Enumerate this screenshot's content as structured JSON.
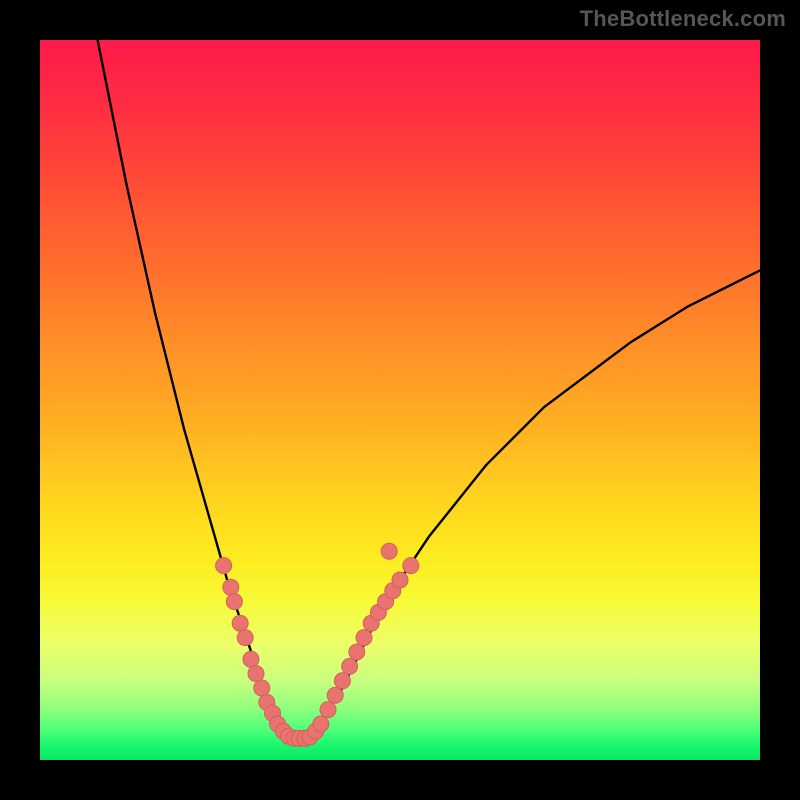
{
  "watermark": "TheBottleneck.com",
  "colors": {
    "background": "#000000",
    "curve": "#000000",
    "marker_fill": "#e9736f",
    "marker_stroke": "#d3605c",
    "gradient_stops": [
      {
        "pos": 0.0,
        "hex": "#ff1a4b"
      },
      {
        "pos": 0.3,
        "hex": "#ff6a2e"
      },
      {
        "pos": 0.64,
        "hex": "#ffd41e"
      },
      {
        "pos": 0.84,
        "hex": "#ecff6a"
      },
      {
        "pos": 1.0,
        "hex": "#0be765"
      }
    ]
  },
  "chart_data": {
    "type": "line",
    "title": "",
    "xlabel": "",
    "ylabel": "",
    "xlim": [
      0,
      100
    ],
    "ylim": [
      0,
      100
    ],
    "note": "y is plotted with 0 at bottom, 100 at top; values are estimated from pixel positions",
    "series": [
      {
        "name": "left-branch",
        "x": [
          8,
          10,
          12,
          14,
          16,
          18,
          20,
          22,
          24,
          26,
          27,
          28,
          29,
          30,
          31,
          32,
          33,
          34,
          35,
          36
        ],
        "y": [
          100,
          90,
          80,
          71,
          62,
          54,
          46,
          39,
          32,
          25,
          22,
          19,
          16,
          13,
          10,
          8,
          6,
          4,
          3,
          3
        ]
      },
      {
        "name": "right-branch",
        "x": [
          36,
          37,
          38,
          39,
          40,
          42,
          44,
          46,
          48,
          50,
          54,
          58,
          62,
          66,
          70,
          74,
          78,
          82,
          86,
          90,
          94,
          98,
          100
        ],
        "y": [
          3,
          3,
          4,
          5,
          7,
          10,
          14,
          18,
          21,
          25,
          31,
          36,
          41,
          45,
          49,
          52,
          55,
          58,
          60.5,
          63,
          65,
          67,
          68
        ]
      }
    ],
    "markers": [
      {
        "name": "left-cluster",
        "points": [
          {
            "x": 25.5,
            "y": 27
          },
          {
            "x": 26.5,
            "y": 24
          },
          {
            "x": 27.0,
            "y": 22
          },
          {
            "x": 27.8,
            "y": 19
          },
          {
            "x": 28.5,
            "y": 17
          },
          {
            "x": 29.3,
            "y": 14
          },
          {
            "x": 30.0,
            "y": 12
          },
          {
            "x": 30.8,
            "y": 10
          },
          {
            "x": 31.5,
            "y": 8
          },
          {
            "x": 32.3,
            "y": 6.5
          },
          {
            "x": 33.0,
            "y": 5
          },
          {
            "x": 33.8,
            "y": 4
          },
          {
            "x": 34.5,
            "y": 3.3
          },
          {
            "x": 35.3,
            "y": 3
          },
          {
            "x": 36.0,
            "y": 3
          },
          {
            "x": 36.8,
            "y": 3
          },
          {
            "x": 37.5,
            "y": 3.2
          }
        ]
      },
      {
        "name": "right-cluster",
        "points": [
          {
            "x": 38.3,
            "y": 4
          },
          {
            "x": 39.0,
            "y": 5
          },
          {
            "x": 40.0,
            "y": 7
          },
          {
            "x": 41.0,
            "y": 9
          },
          {
            "x": 42.0,
            "y": 11
          },
          {
            "x": 43.0,
            "y": 13
          },
          {
            "x": 44.0,
            "y": 15
          },
          {
            "x": 45.0,
            "y": 17
          },
          {
            "x": 46.0,
            "y": 19
          },
          {
            "x": 47.0,
            "y": 20.5
          },
          {
            "x": 48.0,
            "y": 22
          },
          {
            "x": 49.0,
            "y": 23.5
          },
          {
            "x": 50.0,
            "y": 25
          },
          {
            "x": 51.5,
            "y": 27
          }
        ]
      },
      {
        "name": "outlier",
        "points": [
          {
            "x": 48.5,
            "y": 29
          }
        ]
      }
    ]
  }
}
